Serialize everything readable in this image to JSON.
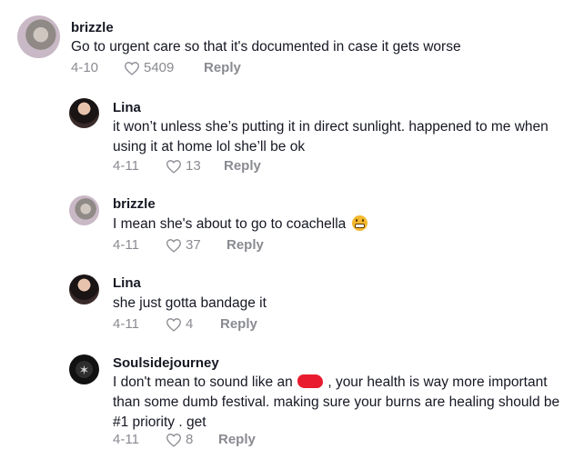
{
  "comments": [
    {
      "author": "brizzle",
      "text": "Go to urgent care so that it's documented in case it gets worse",
      "date": "4-10",
      "likes": "5409",
      "reply": "Reply"
    },
    {
      "author": "Lina",
      "text": "it won’t unless she’s putting it in direct sunlight. happened to me when using it at home lol she’ll be ok",
      "date": "4-11",
      "likes": "13",
      "reply": "Reply"
    },
    {
      "author": "brizzle",
      "text": "I mean she's about to go to coachella",
      "emoji": "grimacing-face",
      "date": "4-11",
      "likes": "37",
      "reply": "Reply"
    },
    {
      "author": "Lina",
      "text": "she just gotta bandage it",
      "date": "4-11",
      "likes": "4",
      "reply": "Reply"
    },
    {
      "author": "Soulsidejourney",
      "text_before_censor": "I don't mean to sound like an",
      "text_after_censor": ", your health is way more important than some dumb festival. making sure your burns are healing should be #1 priority . get",
      "censor_color": "#e81c2e",
      "date": "4-11",
      "likes": "8",
      "reply": "Reply"
    }
  ]
}
